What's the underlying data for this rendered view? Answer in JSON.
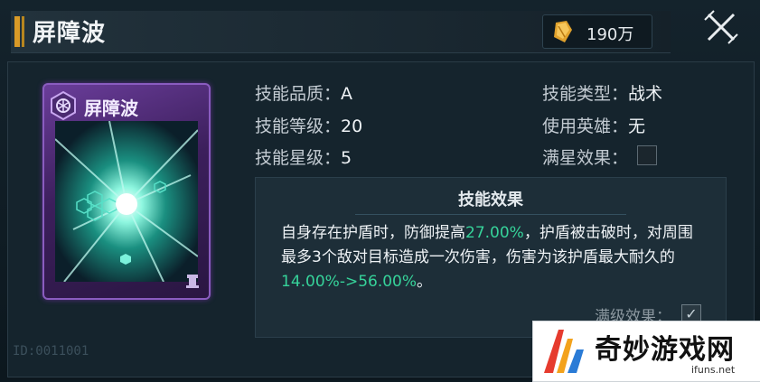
{
  "header": {
    "title": "屏障波",
    "currency_value": "190万"
  },
  "card": {
    "name": "屏障波"
  },
  "attributes": {
    "quality_label": "技能品质：",
    "quality_value": "A",
    "level_label": "技能等级：",
    "level_value": "20",
    "star_label": "技能星级：",
    "star_value": "5",
    "type_label": "技能类型：",
    "type_value": "战术",
    "hero_label": "使用英雄：",
    "hero_value": "无",
    "fullstar_label": "满星效果："
  },
  "effect": {
    "title": "技能效果",
    "line1_a": "自身存在护盾时，防御提高",
    "line1_hl": "27.00%",
    "line1_b": "，护盾被击破时，对周围最多3个敌对目标造成一次伤害，伤害为该护盾最大耐久的",
    "line1_hl2": "14.00%->56.00%",
    "line1_c": "。",
    "maxlevel_label": "满级效果："
  },
  "uid_text": "ID:0011001",
  "watermark": {
    "name": "奇妙游戏网",
    "url": "ifuns.net"
  },
  "colors": {
    "highlight": "#36d39a",
    "accent": "#d99a27",
    "card_purple": "#6a3d9a"
  }
}
